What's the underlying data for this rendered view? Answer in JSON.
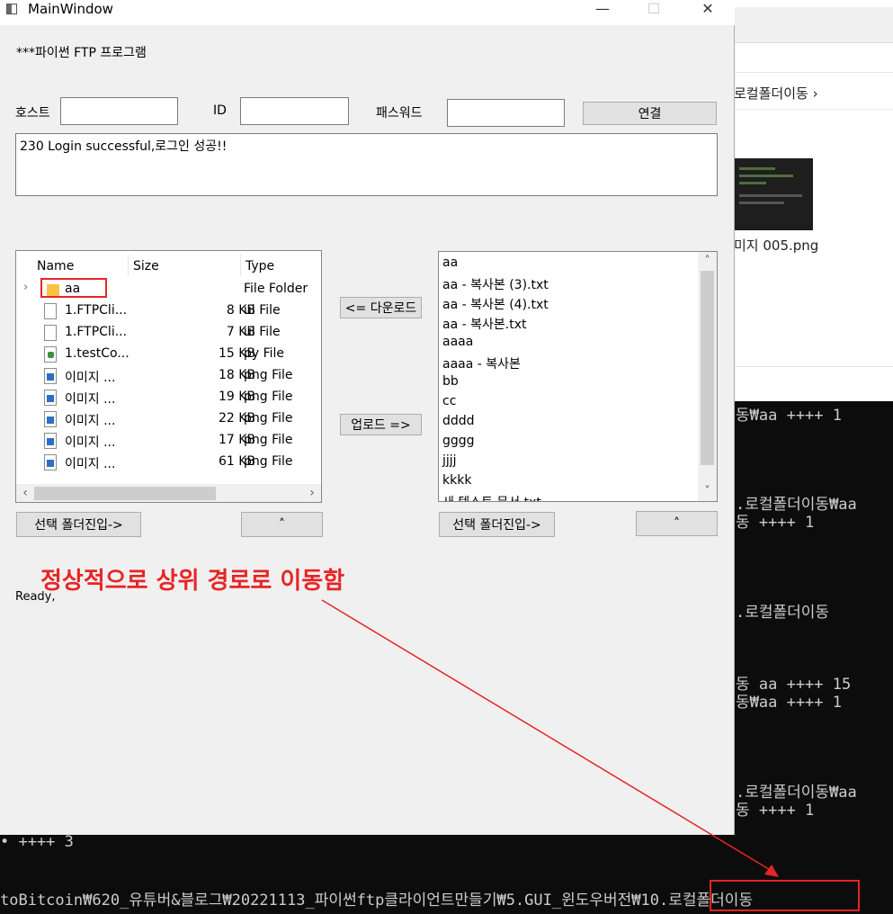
{
  "window": {
    "title": "MainWindow",
    "controls": {
      "minimize": "—",
      "maximize": "☐",
      "close": "✕"
    }
  },
  "heading": "***파이썬 FTP 프로그램",
  "connection": {
    "host_label": "호스트",
    "host_value": "",
    "id_label": "ID",
    "id_value": "",
    "password_label": "패스워드",
    "password_value": "",
    "connect_button": "연결"
  },
  "log_text": "230 Login successful,로그인 성공!!",
  "local": {
    "columns": [
      "Name",
      "Size",
      "Type"
    ],
    "rows": [
      {
        "name": "aa",
        "size": "",
        "type": "File Folder",
        "icon": "folder-icon"
      },
      {
        "name": "1.FTPCli...",
        "size": "8 KB",
        "type": "ui File",
        "icon": "file-icon"
      },
      {
        "name": "1.FTPCli...",
        "size": "7 KB",
        "type": "ui File",
        "icon": "file-icon"
      },
      {
        "name": "1.testCo...",
        "size": "15 KB",
        "type": "py File",
        "icon": "python-file-icon"
      },
      {
        "name": "이미지 ...",
        "size": "18 KB",
        "type": "png File",
        "icon": "image-file-icon"
      },
      {
        "name": "이미지 ...",
        "size": "19 KB",
        "type": "png File",
        "icon": "image-file-icon"
      },
      {
        "name": "이미지 ...",
        "size": "22 KB",
        "type": "png File",
        "icon": "image-file-icon"
      },
      {
        "name": "이미지 ...",
        "size": "17 KB",
        "type": "png File",
        "icon": "image-file-icon"
      },
      {
        "name": "이미지 ...",
        "size": "61 KB",
        "type": "png File",
        "icon": "image-file-icon"
      }
    ],
    "enter_folder_button": "선택 폴더진입->",
    "up_button": "˄"
  },
  "transfer": {
    "download_button": "<= 다운로드",
    "upload_button": "업로드 =>"
  },
  "remote": {
    "items": [
      "aa",
      "aa - 복사본 (3).txt",
      "aa - 복사본 (4).txt",
      "aa - 복사본.txt",
      "aaaa",
      "aaaa - 복사본",
      "bb",
      "cc",
      "dddd",
      "gggg",
      "jjjj",
      "kkkk",
      "새 텍스트 문서.txt"
    ],
    "enter_folder_button": "선택 폴더진입->",
    "up_button": "˄"
  },
  "status": "Ready,",
  "annotation": "정상적으로 상위 경로로 이동함",
  "background": {
    "explorer_breadcrumb": "로컬폴더이동 ›",
    "explorer_thumbnail_name": "미지 005.png",
    "console_lines": [
      "동₩aa ++++ 1",
      ".로컬폴더이동₩aa",
      "동 ++++ 1",
      ".로컬폴더이동",
      "동 aa ++++ 15",
      "동₩aa ++++ 1",
      ".로컬폴더이동₩aa",
      "동 ++++ 1",
      "• ++++ 3",
      "toBitcoin₩620_유튜버&블로그₩20221113_파이썬ftp클라이언트만들기₩5.GUI_윈도우버전₩10.로컬폴더이동"
    ]
  },
  "colors": {
    "annotation": "#e82424",
    "window_bg": "#f0f0f0",
    "console_bg": "#0c0c0c",
    "console_text": "#cccccc"
  }
}
